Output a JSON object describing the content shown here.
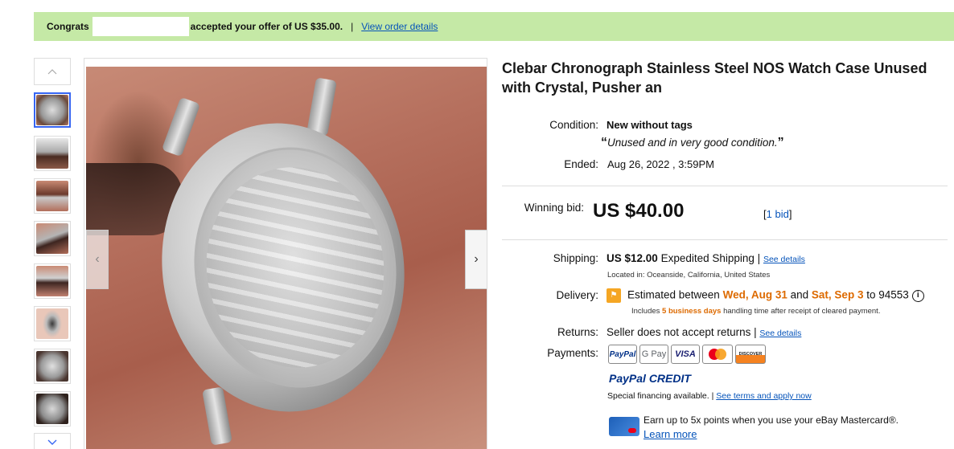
{
  "banner": {
    "prefix": "Congrats",
    "message": "accepted your offer of US $35.00.",
    "separator": "|",
    "link": "View order details"
  },
  "gallery": {
    "up_icon": "chevron-up-icon",
    "down_icon": "chevron-down-icon",
    "thumb_count": 8,
    "selected_index": 0,
    "prev_icon": "chevron-left-icon",
    "next_icon": "chevron-right-icon"
  },
  "item": {
    "title": "Clebar Chronograph Stainless Steel NOS Watch Case Unused with Crystal, Pusher an"
  },
  "details": {
    "condition_label": "Condition:",
    "condition_value": "New without tags",
    "condition_quote_open": "“",
    "condition_note": "Unused and in very good condition.",
    "condition_quote_close": "”",
    "ended_label": "Ended:",
    "ended_value": "Aug 26, 2022 , 3:59PM",
    "winning_label": "Winning bid:",
    "winning_value": "US $40.00",
    "bids_open": "[",
    "bids_link": "1 bid",
    "bids_close": "]"
  },
  "shipping": {
    "label": "Shipping:",
    "price": "US $12.00",
    "method": "Expedited Shipping",
    "sep": "|",
    "see_details": "See details",
    "location": "Located in: Oceanside, California, United States"
  },
  "delivery": {
    "label": "Delivery:",
    "prefix": "Estimated between",
    "date1": "Wed, Aug 31",
    "and": "and",
    "date2": "Sat, Sep 3",
    "to": "to 94553",
    "info_icon": "info-icon",
    "note_prefix": "Includes",
    "note_days": "5 business days",
    "note_suffix": "handling time after receipt of cleared payment."
  },
  "returns": {
    "label": "Returns:",
    "value": "Seller does not accept returns",
    "sep": "|",
    "see_details": "See details"
  },
  "payments": {
    "label": "Payments:",
    "logos": [
      "PayPal",
      "G Pay",
      "VISA",
      "Mastercard",
      "DISCOVER"
    ],
    "paypal_credit": "PayPal CREDIT",
    "financing": "Special financing available.",
    "sep": "|",
    "terms_link": "See terms and apply now",
    "mastercard_text": "Earn up to 5x points when you use your eBay Mastercard®.",
    "learn_more": "Learn more"
  },
  "colors": {
    "banner_bg": "#c5e9a6",
    "link": "#0654ba",
    "accent_orange": "#dd6a00",
    "selected_thumb_border": "#3665f3"
  }
}
